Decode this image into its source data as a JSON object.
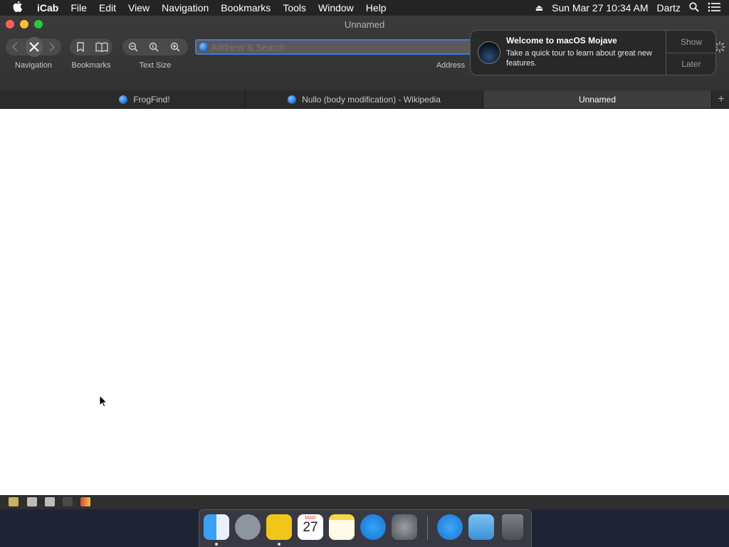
{
  "menubar": {
    "app": "iCab",
    "items": [
      "File",
      "Edit",
      "View",
      "Navigation",
      "Bookmarks",
      "Tools",
      "Window",
      "Help"
    ],
    "clock": "Sun Mar 27  10:34 AM",
    "user": "Dartz"
  },
  "window": {
    "title": "Unnamed",
    "toolbar": {
      "navigation_label": "Navigation",
      "bookmarks_label": "Bookmarks",
      "text_size_label": "Text Size",
      "address_label": "Address",
      "address_placeholder": "Address & Search"
    },
    "tabs": [
      {
        "label": "FrogFind!",
        "active": false
      },
      {
        "label": "Nullo (body modification) - Wikipedia",
        "active": false
      },
      {
        "label": "Unnamed",
        "active": true
      }
    ]
  },
  "notification": {
    "title": "Welcome to macOS Mojave",
    "body": "Take a quick tour to learn about great new features.",
    "show_label": "Show",
    "later_label": "Later"
  },
  "dock": {
    "calendar_month": "MAR",
    "calendar_day": "27",
    "apps": [
      "finder-icon",
      "launchpad-icon",
      "icab-icon",
      "calendar-icon",
      "notes-icon",
      "app-store-icon",
      "system-preferences-icon",
      "applications-folder-icon",
      "documents-folder-icon",
      "trash-icon"
    ]
  },
  "colors": {
    "menubar": "#242424",
    "toolbar": "#363636",
    "address_focus": "#3a7fd6",
    "desktop": "#1e2433"
  }
}
